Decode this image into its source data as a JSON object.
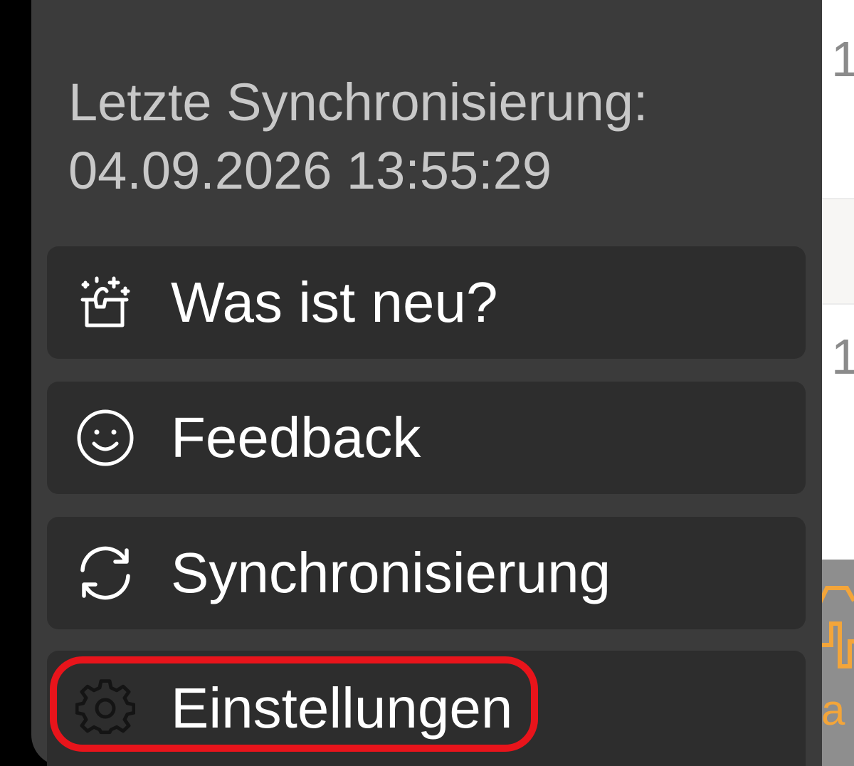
{
  "sync_info": {
    "label": "Letzte Synchronisierung:",
    "timestamp": "04.09.2026 13:55:29"
  },
  "menu_items": [
    {
      "label": "Was ist neu?",
      "icon": "sparkle-box-icon"
    },
    {
      "label": "Feedback",
      "icon": "smiley-icon"
    },
    {
      "label": "Synchronisierung",
      "icon": "sync-arrows-icon"
    },
    {
      "label": "Einstellungen",
      "icon": "gear-icon"
    }
  ],
  "background_app": {
    "row_digits": [
      "1",
      "1"
    ],
    "thumbnail_text": "a"
  },
  "colors": {
    "menu_background": "#3b3b3b",
    "item_background": "#2d2d2d",
    "secondary_text": "#c8c8c8",
    "primary_text": "#ffffff",
    "highlight": "#e8141b",
    "accent": "#f3a53a"
  }
}
